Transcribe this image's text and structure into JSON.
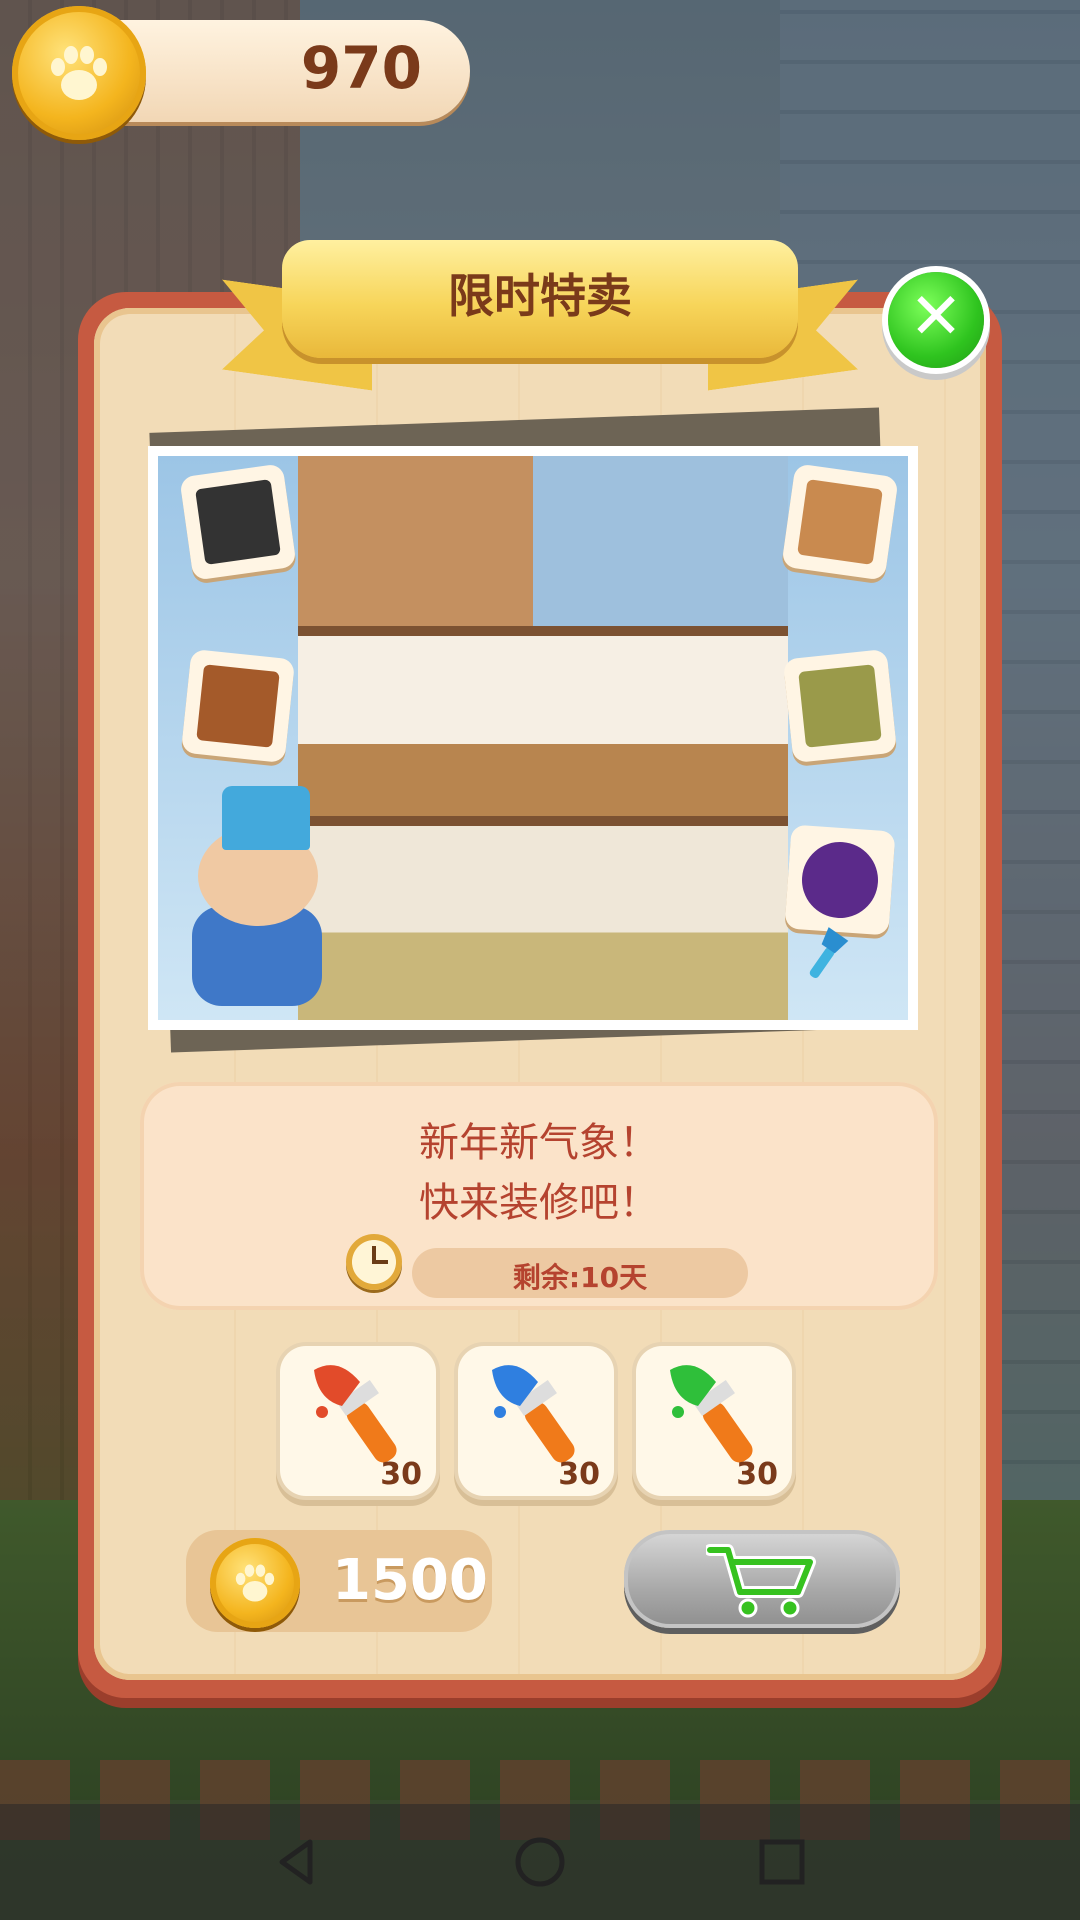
{
  "currency": {
    "coins": "970"
  },
  "offer": {
    "title": "限时特卖",
    "message_line1": "新年新气象！",
    "message_line2": "快来装修吧！",
    "time_remaining": "剩余:10天",
    "items": [
      {
        "icon": "red-paintbrush-icon",
        "count": "30",
        "color": "#e24b2a"
      },
      {
        "icon": "blue-paintbrush-icon",
        "count": "30",
        "color": "#2f7fe0"
      },
      {
        "icon": "green-paintbrush-icon",
        "count": "30",
        "color": "#2fbf3a"
      }
    ],
    "price": "1500"
  },
  "colors": {
    "panel_border": "#c65a41",
    "ribbon": "#f7d55a",
    "close_button": "#2fc41f",
    "message_text": "#b5432f"
  },
  "icons": [
    "paw-coin-icon",
    "close-icon",
    "clock-icon",
    "cart-icon",
    "back-icon",
    "home-icon",
    "recents-icon"
  ]
}
